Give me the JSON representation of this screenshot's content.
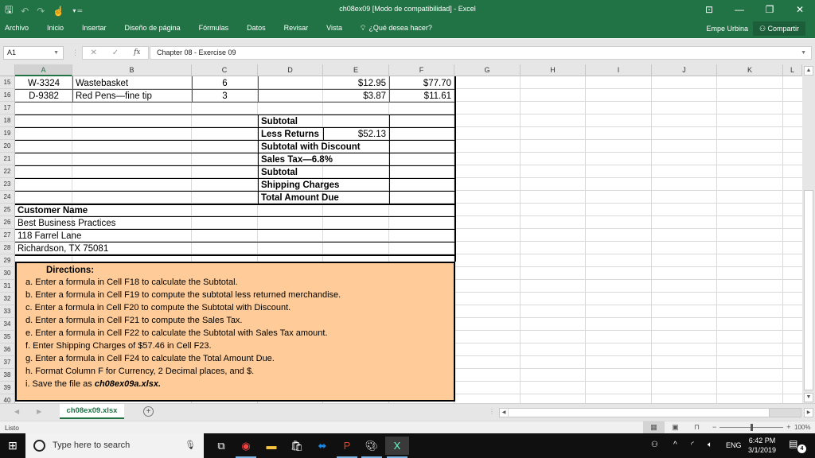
{
  "app": {
    "window_title": "ch08ex09  [Modo de compatibilidad] - Excel",
    "qat": {
      "save_icon": "save-icon",
      "undo_icon": "undo-icon",
      "redo_icon": "redo-icon",
      "touch_icon": "touch-mode-icon"
    },
    "window_controls": {
      "ribbon_display": "⊡",
      "minimize": "—",
      "restore": "❐",
      "close": "✕"
    }
  },
  "ribbon": {
    "tabs": [
      "Archivo",
      "Inicio",
      "Insertar",
      "Diseño de página",
      "Fórmulas",
      "Datos",
      "Revisar",
      "Vista"
    ],
    "tell_me": "¿Qué desea hacer?",
    "user": "Empe Urbina",
    "share": "Compartir"
  },
  "formula_bar": {
    "name_box": "A1",
    "formula": "Chapter 08 - Exercise 09"
  },
  "sheet": {
    "columns": [
      "A",
      "B",
      "C",
      "D",
      "E",
      "F",
      "G",
      "H",
      "I",
      "J",
      "K",
      "L"
    ],
    "rows": [
      "15",
      "16",
      "17",
      "18",
      "19",
      "20",
      "21",
      "22",
      "23",
      "24",
      "25",
      "26",
      "27",
      "28",
      "29",
      "30",
      "31",
      "32",
      "33",
      "34",
      "35",
      "36",
      "37",
      "38",
      "39",
      "40"
    ],
    "items": [
      {
        "code": "W-3324",
        "description": "Wastebasket",
        "qty": "6",
        "price": "$12.95",
        "total": "$77.70"
      },
      {
        "code": "D-9382",
        "description": "Red Pens—fine tip",
        "qty": "3",
        "price": "$3.87",
        "total": "$11.61"
      }
    ],
    "summary": [
      {
        "label": "Subtotal",
        "value": ""
      },
      {
        "label": "Less Returns",
        "value": "$52.13"
      },
      {
        "label": "Subtotal with Discount",
        "value": ""
      },
      {
        "label": "Sales Tax—6.8%",
        "value": ""
      },
      {
        "label": "Subtotal",
        "value": ""
      },
      {
        "label": "Shipping Charges",
        "value": ""
      },
      {
        "label": "Total Amount Due",
        "value": ""
      }
    ],
    "customer": {
      "heading": "Customer Name",
      "lines": [
        "Best Business Practices",
        "118 Farrel Lane",
        "Richardson, TX 75081"
      ]
    },
    "directions": {
      "heading": "Directions:",
      "items": [
        "a.  Enter a formula in Cell F18 to calculate the Subtotal.",
        "b.  Enter a formula in Cell F19 to compute the subtotal less returned merchandise.",
        "c.  Enter a formula in Cell F20 to compute the Subtotal with Discount.",
        "d.  Enter a formula in Cell F21 to compute the Sales Tax.",
        "e.  Enter a formula in Cell F22 to calculate the Subtotal with Sales Tax amount.",
        "f.  Enter Shipping Charges of $57.46 in Cell F23.",
        "g.  Enter a formula in Cell F24 to calculate the Total Amount Due.",
        "h.  Format Column F for Currency, 2 Decimal places, and $."
      ],
      "last_prefix": "i.  Save the file as ",
      "last_filename": "ch08ex09a.xlsx."
    }
  },
  "sheet_tabs": {
    "active": "ch08ex09.xlsx",
    "add": "+"
  },
  "status": {
    "text": "Listo",
    "zoom": "100%",
    "zoom_fraction": 0.5
  },
  "taskbar": {
    "search_placeholder": "Type here to search",
    "language": "ENG",
    "time": "6:42 PM",
    "date": "3/1/2019",
    "notifications": "4"
  },
  "colors": {
    "excel_green": "#217346",
    "directions_fill": "#ffcc99"
  }
}
